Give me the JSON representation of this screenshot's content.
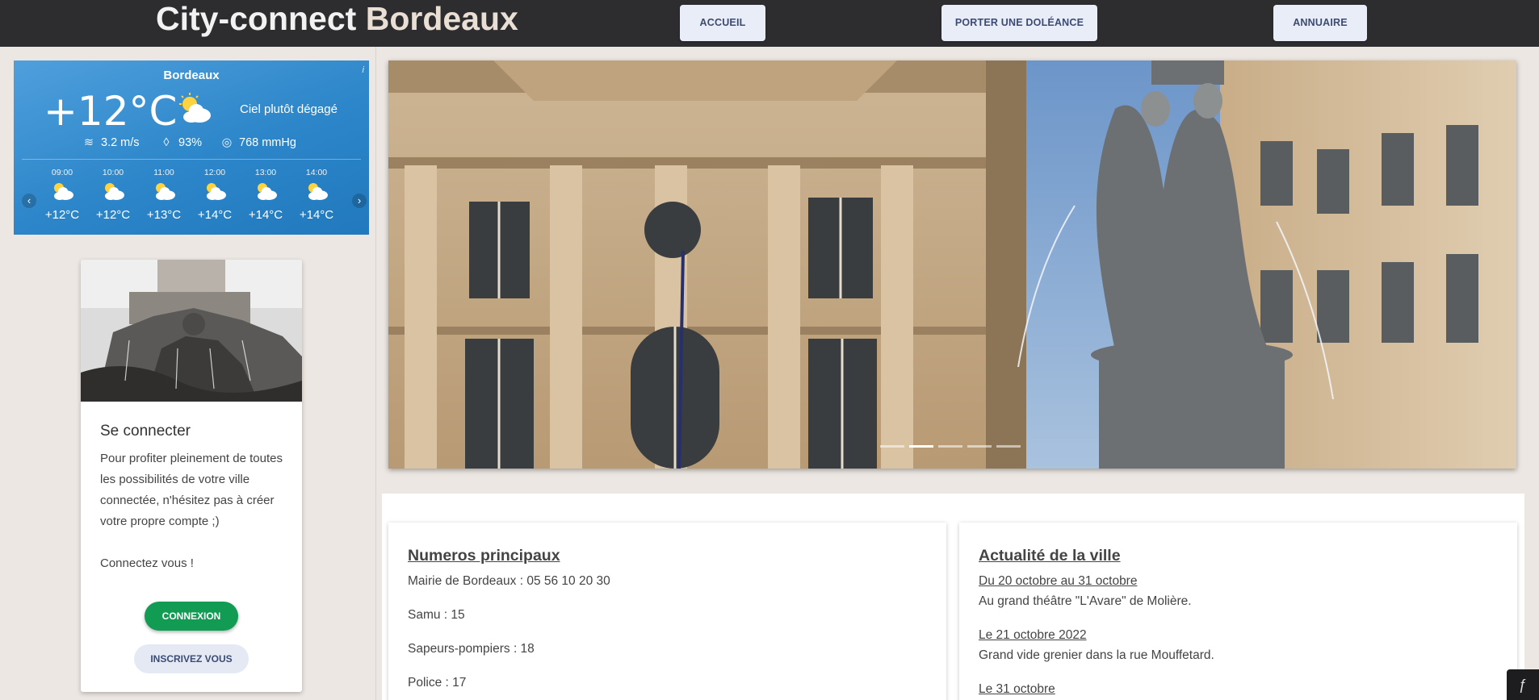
{
  "header": {
    "brand_part1": "City-connect",
    "brand_part2": "Bordeaux",
    "nav": [
      {
        "label": "ACCUEIL"
      },
      {
        "label": "PORTER UNE DOLÉANCE"
      },
      {
        "label": "ANNUAIRE"
      }
    ]
  },
  "weather": {
    "city": "Bordeaux",
    "info": "i",
    "temperature": "+12°C",
    "description": "Ciel plutôt dégagé",
    "wind": "3.2 m/s",
    "humidity": "93%",
    "pressure": "768 mmHg",
    "icon": "partly-cloudy-icon",
    "hourly": [
      {
        "time": "09:00",
        "temp": "+12°C"
      },
      {
        "time": "10:00",
        "temp": "+12°C"
      },
      {
        "time": "11:00",
        "temp": "+13°C"
      },
      {
        "time": "12:00",
        "temp": "+14°C"
      },
      {
        "time": "13:00",
        "temp": "+14°C"
      },
      {
        "time": "14:00",
        "temp": "+14°C"
      }
    ],
    "prev_arrow": "‹",
    "next_arrow": "›"
  },
  "login": {
    "title": "Se connecter",
    "text": "Pour profiter pleinement de toutes les possibilités de votre ville connectée, n'hésitez pas à créer votre propre compte ;)",
    "cta": "Connectez vous !",
    "connect_label": "CONNEXION",
    "signup_label": "INSCRIVEZ VOUS"
  },
  "carousel": {
    "slide_count": 5,
    "active_index": 1
  },
  "numbers": {
    "title": "Numeros principaux",
    "items": [
      "Mairie de Bordeaux : 05 56 10 20 30",
      "Samu : 15",
      "Sapeurs-pompiers : 18",
      "Police : 17"
    ]
  },
  "news": {
    "title": "Actualité de la ville",
    "items": [
      {
        "date": "Du 20 octobre au 31 octobre",
        "desc": "Au grand théâtre \"L'Avare\" de Molière."
      },
      {
        "date": "Le 21 octobre 2022",
        "desc": "Grand vide grenier dans la rue Mouffetard."
      },
      {
        "date": "Le 31 octobre",
        "desc": ""
      }
    ]
  },
  "colors": {
    "header_bg": "#2d2d2f",
    "accent_green": "#129b53",
    "weather_blue": "#2c86c9"
  }
}
